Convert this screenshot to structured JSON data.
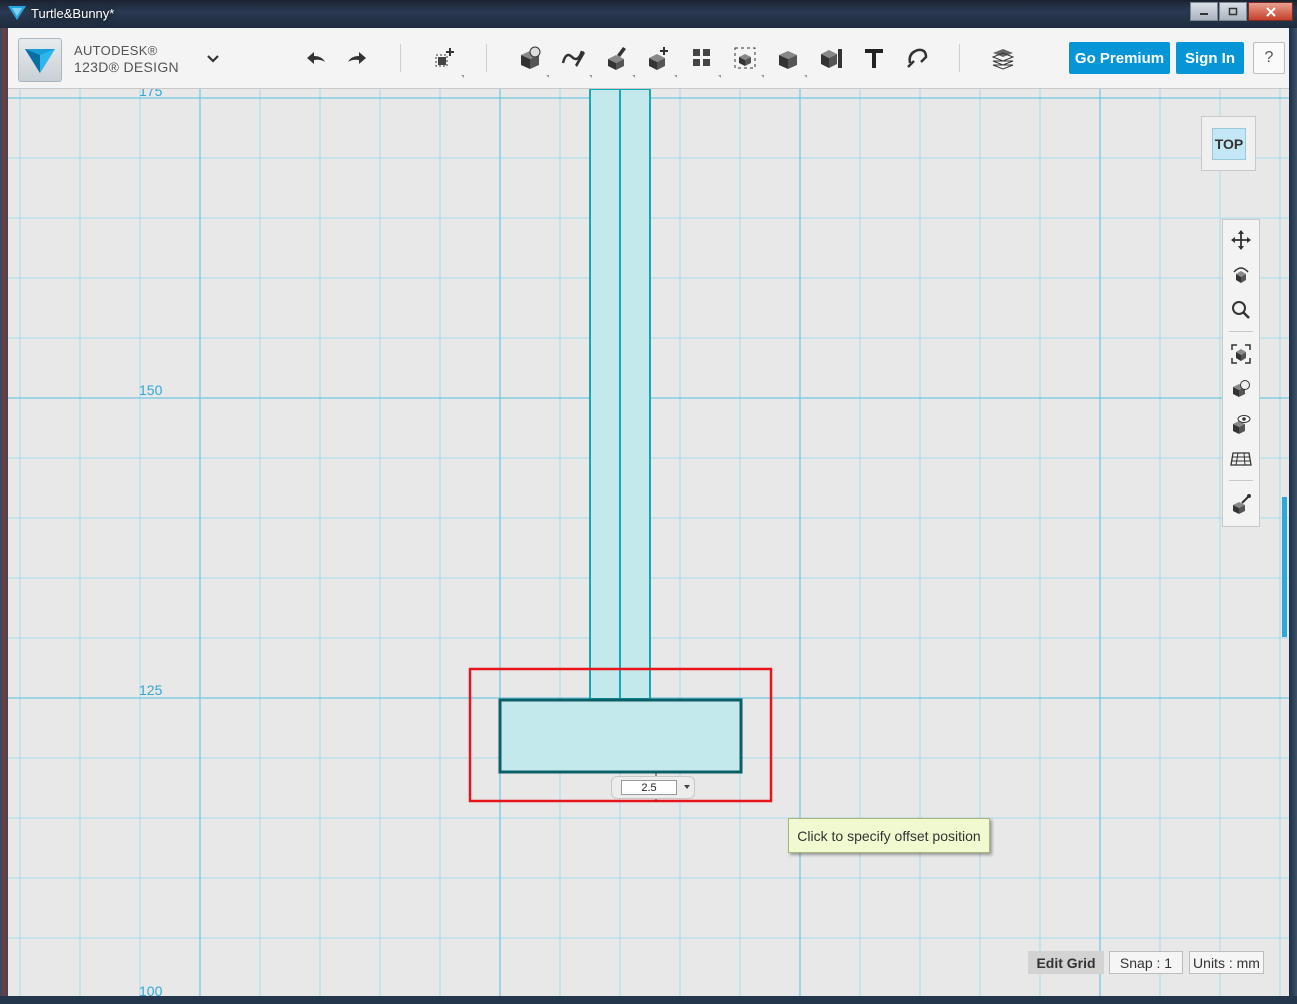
{
  "window": {
    "title": "Turtle&Bunny*",
    "controls": {
      "minimize_icon": "minimize-icon",
      "maximize_icon": "maximize-icon",
      "close_icon": "close-icon"
    }
  },
  "app": {
    "brand_line1": "AUTODESK®",
    "brand_line2": "123D® DESIGN",
    "menu_icon": "chevron-down-icon"
  },
  "toolbar": {
    "undo_icon": "undo-icon",
    "redo_icon": "redo-icon",
    "tools": [
      {
        "name": "transform-tool",
        "icon": "transform-icon"
      },
      {
        "name": "primitives-tool",
        "icon": "primitives-icon"
      },
      {
        "name": "sketch-tool",
        "icon": "sketch-icon"
      },
      {
        "name": "construct-tool",
        "icon": "construct-icon"
      },
      {
        "name": "modify-tool",
        "icon": "modify-icon"
      },
      {
        "name": "pattern-tool",
        "icon": "pattern-icon"
      },
      {
        "name": "group-tool",
        "icon": "group-icon"
      },
      {
        "name": "combine-tool",
        "icon": "combine-icon"
      },
      {
        "name": "measure-tool",
        "icon": "measure-icon"
      },
      {
        "name": "text-tool",
        "icon": "text-icon"
      },
      {
        "name": "snap-tool",
        "icon": "snap-icon"
      },
      {
        "name": "materials-tool",
        "icon": "materials-icon"
      }
    ],
    "go_premium_label": "Go Premium",
    "sign_in_label": "Sign In",
    "help_label": "?"
  },
  "viewport": {
    "viewcube_label": "TOP",
    "axis_labels": [
      "175",
      "150",
      "125",
      "100"
    ],
    "accent_color": "#2da8d8",
    "shape_fill": "#c4e9ec",
    "shape_stroke": "#0b5f66",
    "selection_color": "#e8141b"
  },
  "offset_input": {
    "value": "2.5"
  },
  "tooltip": {
    "text": "Click to specify offset position"
  },
  "navbar": {
    "icons": [
      "pan-icon",
      "orbit-icon",
      "zoom-icon",
      "fit-icon",
      "materials-outlines-icon",
      "visibility-icon",
      "grid-toggle-icon",
      "snap-settings-icon"
    ]
  },
  "status": {
    "edit_grid": "Edit Grid",
    "snap": "Snap : 1",
    "units": "Units : mm"
  }
}
